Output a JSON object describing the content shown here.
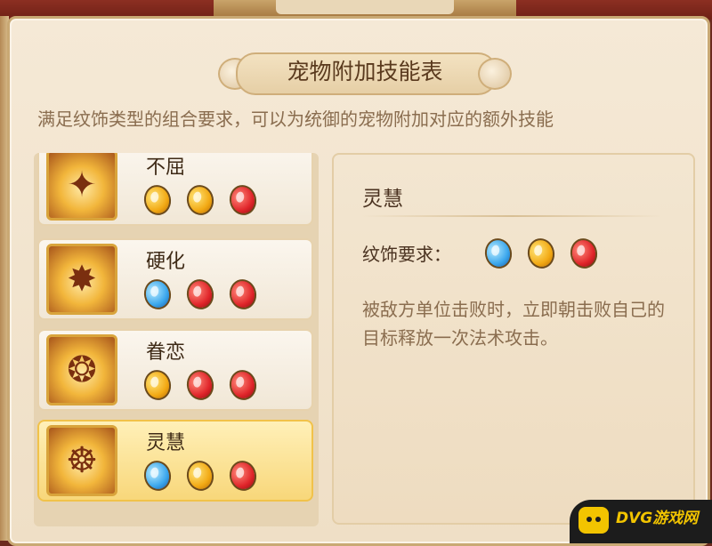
{
  "header": {
    "title": "宠物附加技能表",
    "subtitle": "满足纹饰类型的组合要求，可以为统御的宠物附加对应的额外技能"
  },
  "skills": [
    {
      "name": "不屈",
      "gems": [
        "gold",
        "gold",
        "red"
      ],
      "selected": false
    },
    {
      "name": "硬化",
      "gems": [
        "blue",
        "red",
        "red"
      ],
      "selected": false
    },
    {
      "name": "眷恋",
      "gems": [
        "gold",
        "red",
        "red"
      ],
      "selected": false
    },
    {
      "name": "灵慧",
      "gems": [
        "blue",
        "gold",
        "red"
      ],
      "selected": true
    }
  ],
  "detail": {
    "title": "灵慧",
    "requirement_label": "纹饰要求：",
    "requirement_gems": [
      "blue",
      "gold",
      "red"
    ],
    "description": "被敌方单位击败时，立即朝击败自己的目标释放一次法术攻击。"
  },
  "watermark": {
    "text": "DVG游戏网"
  },
  "colors": {
    "gold_gem": "#f2a914",
    "red_gem": "#e0252a",
    "blue_gem": "#3aa6ec",
    "selected_card": "#f8d77a"
  }
}
